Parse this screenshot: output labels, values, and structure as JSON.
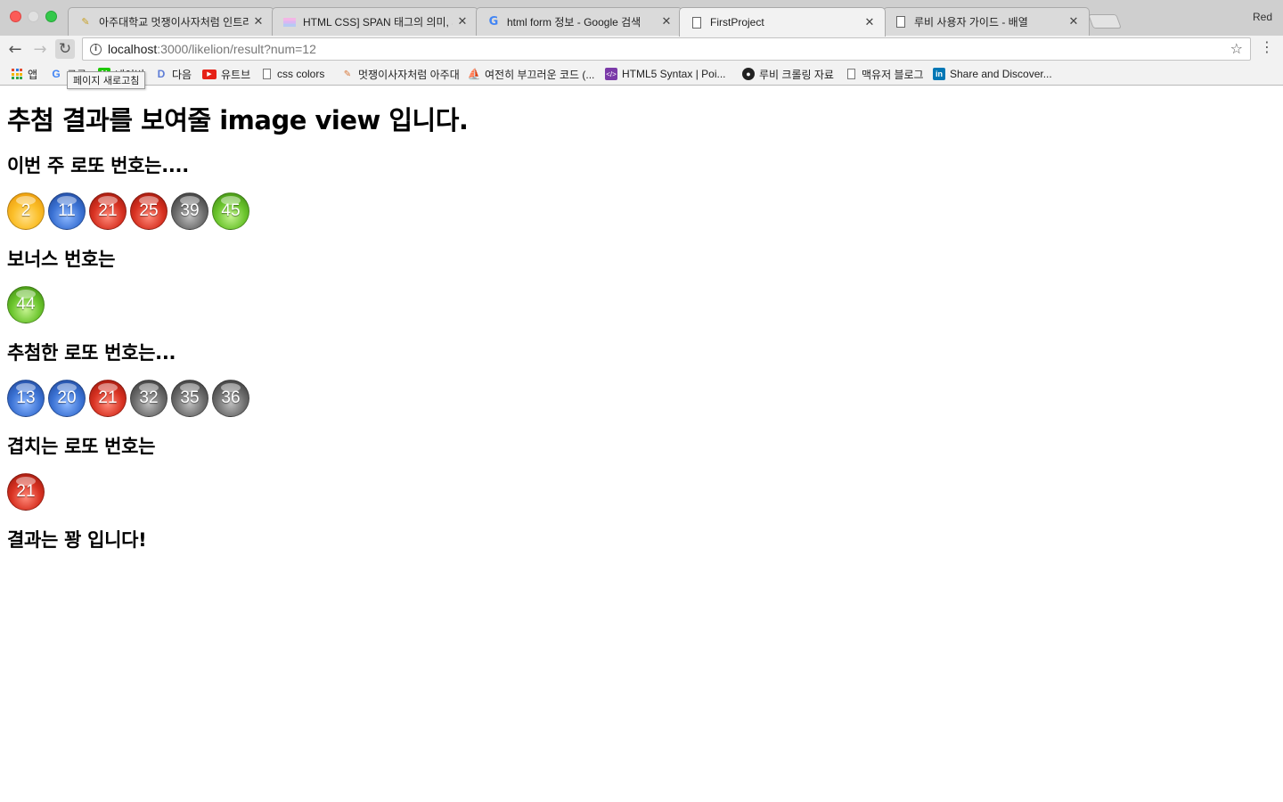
{
  "browser": {
    "profile_label": "Red",
    "tabs": [
      {
        "title": "아주대학교 멋쟁이사자처럼 인트라넷",
        "favicon": "folder-icon",
        "active": false
      },
      {
        "title": "HTML CSS] SPAN 태그의 의미, 사",
        "favicon": "stripe-icon",
        "active": false
      },
      {
        "title": "html form 정보 - Google 검색",
        "favicon": "google-icon",
        "active": false
      },
      {
        "title": "FirstProject",
        "favicon": "page-icon",
        "active": true
      },
      {
        "title": "루비 사용자 가이드 - 배열",
        "favicon": "page-icon",
        "active": false
      }
    ],
    "url_host": "localhost",
    "url_rest": ":3000/likelion/result?num=12",
    "tooltip": "페이지 새로고침",
    "bookmarks": [
      {
        "label": "앱",
        "icon": "apps-icon"
      },
      {
        "label": "구글",
        "icon": "google-icon"
      },
      {
        "label": "네이버",
        "icon": "naver-icon"
      },
      {
        "label": "다음",
        "icon": "daum-icon"
      },
      {
        "label": "유트브",
        "icon": "youtube-icon"
      },
      {
        "label": "css colors",
        "icon": "page-icon"
      },
      {
        "label": "멋쟁이사자처럼 아주대",
        "icon": "brush-icon"
      },
      {
        "label": "여전히 부끄러운 코드 (...",
        "icon": "ship-icon"
      },
      {
        "label": "HTML5 Syntax | Poi...",
        "icon": "code-icon"
      },
      {
        "label": "루비 크롤링 자료",
        "icon": "github-icon"
      },
      {
        "label": "맥유저 블로그",
        "icon": "page-icon"
      },
      {
        "label": "Share and Discover...",
        "icon": "linkedin-icon"
      }
    ]
  },
  "page": {
    "title": "추첨 결과를 보여줄 image view 입니다.",
    "weekly_heading": "이번 주 로또 번호는....",
    "weekly_numbers": [
      {
        "num": "2",
        "color": "yellow"
      },
      {
        "num": "11",
        "color": "blue"
      },
      {
        "num": "21",
        "color": "red"
      },
      {
        "num": "25",
        "color": "red"
      },
      {
        "num": "39",
        "color": "gray"
      },
      {
        "num": "45",
        "color": "green"
      }
    ],
    "bonus_heading": "보너스 번호는",
    "bonus_numbers": [
      {
        "num": "44",
        "color": "green"
      }
    ],
    "drawn_heading": "추첨한 로또 번호는...",
    "drawn_numbers": [
      {
        "num": "13",
        "color": "blue"
      },
      {
        "num": "20",
        "color": "blue"
      },
      {
        "num": "21",
        "color": "red"
      },
      {
        "num": "32",
        "color": "gray"
      },
      {
        "num": "35",
        "color": "gray"
      },
      {
        "num": "36",
        "color": "gray"
      }
    ],
    "matched_heading": "겹치는 로또 번호는",
    "matched_numbers": [
      {
        "num": "21",
        "color": "red"
      }
    ],
    "result_text": "결과는 꽝 입니다!"
  }
}
